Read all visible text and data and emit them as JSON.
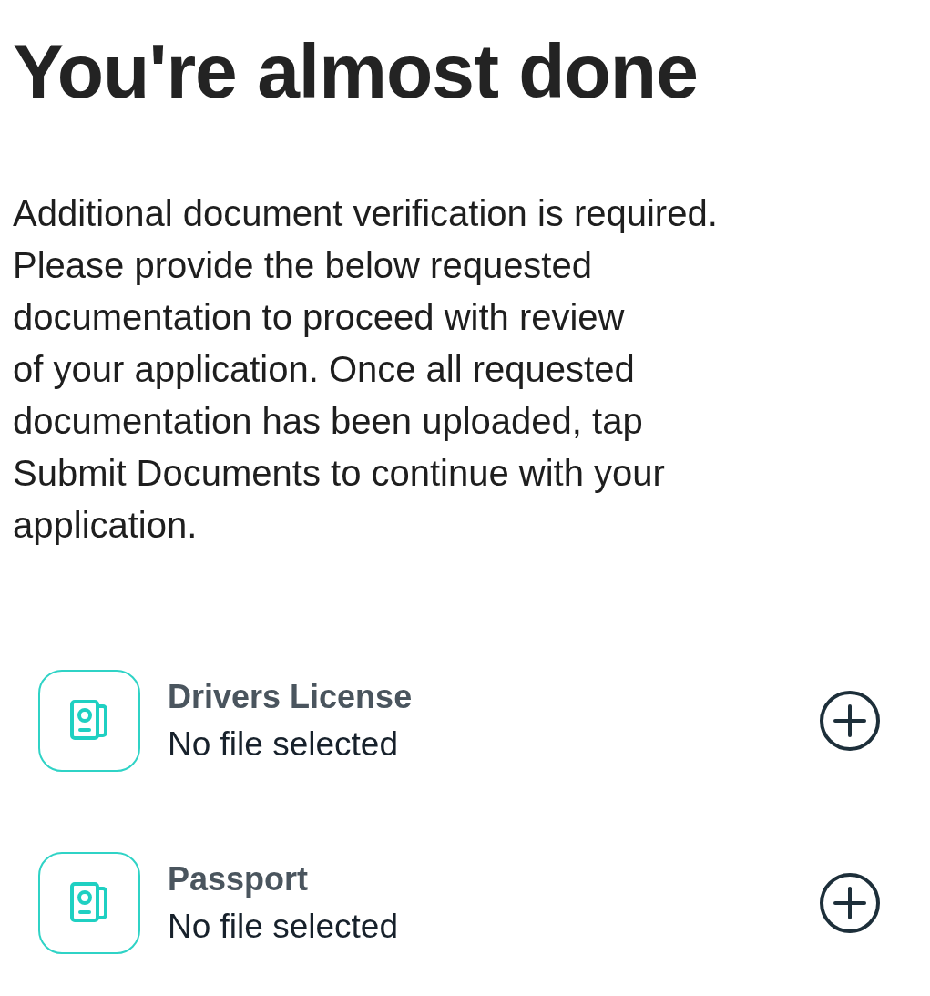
{
  "title": "You're almost done",
  "description": "Additional document verification is required.\nPlease provide the below requested\ndocumentation to proceed with review\nof your application. Once all requested\ndocumentation has been uploaded, tap\nSubmit Documents to continue with your\napplication.",
  "documents": [
    {
      "name": "Drivers License",
      "status": "No file selected"
    },
    {
      "name": "Passport",
      "status": "No file selected"
    }
  ]
}
